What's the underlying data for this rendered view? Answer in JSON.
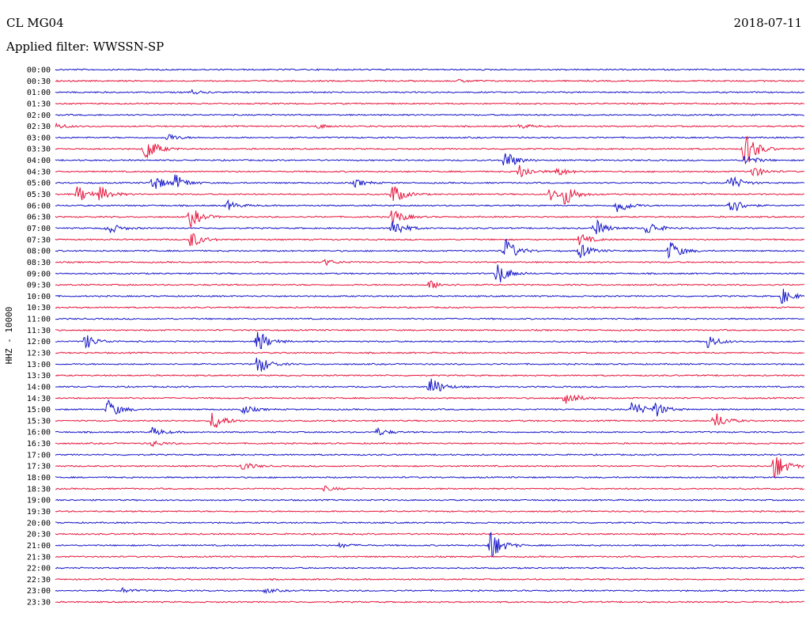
{
  "header": {
    "station": "CL MG04",
    "date": "2018-07-11",
    "filter": "Applied filter: WWSSN-SP"
  },
  "chart_data": {
    "type": "line",
    "ylabel": "HHZ - 10000",
    "tick_labels": [
      "00:00",
      "00:30",
      "01:00",
      "01:30",
      "02:00",
      "02:30",
      "03:00",
      "03:30",
      "04:00",
      "04:30",
      "05:00",
      "05:30",
      "06:00",
      "06:30",
      "07:00",
      "07:30",
      "08:00",
      "08:30",
      "09:00",
      "09:30",
      "10:00",
      "10:30",
      "11:00",
      "11:30",
      "12:00",
      "12:30",
      "13:00",
      "13:30",
      "14:00",
      "14:30",
      "15:00",
      "15:30",
      "16:00",
      "16:30",
      "17:00",
      "17:30",
      "18:00",
      "18:30",
      "19:00",
      "19:30",
      "20:00",
      "20:30",
      "21:00",
      "21:30",
      "22:00",
      "22:30",
      "23:00",
      "23:30"
    ],
    "trace_colors": [
      "#1414c8",
      "#e6143c"
    ],
    "minutes_per_line": 30,
    "events": [
      {
        "row": 1,
        "pos": 0.54,
        "amp": 2
      },
      {
        "row": 2,
        "pos": 0.18,
        "amp": 3
      },
      {
        "row": 5,
        "pos": 0.0,
        "amp": 4
      },
      {
        "row": 5,
        "pos": 0.35,
        "amp": 3
      },
      {
        "row": 5,
        "pos": 0.62,
        "amp": 3
      },
      {
        "row": 6,
        "pos": 0.15,
        "amp": 5
      },
      {
        "row": 7,
        "pos": 0.12,
        "amp": 18
      },
      {
        "row": 7,
        "pos": 0.92,
        "amp": 28
      },
      {
        "row": 8,
        "pos": 0.6,
        "amp": 14
      },
      {
        "row": 8,
        "pos": 0.92,
        "amp": 8
      },
      {
        "row": 9,
        "pos": 0.62,
        "amp": 10
      },
      {
        "row": 9,
        "pos": 0.67,
        "amp": 6
      },
      {
        "row": 9,
        "pos": 0.93,
        "amp": 8
      },
      {
        "row": 10,
        "pos": 0.13,
        "amp": 12
      },
      {
        "row": 10,
        "pos": 0.16,
        "amp": 10
      },
      {
        "row": 10,
        "pos": 0.9,
        "amp": 12
      },
      {
        "row": 10,
        "pos": 0.4,
        "amp": 5
      },
      {
        "row": 11,
        "pos": 0.03,
        "amp": 12
      },
      {
        "row": 11,
        "pos": 0.06,
        "amp": 10
      },
      {
        "row": 11,
        "pos": 0.45,
        "amp": 14
      },
      {
        "row": 11,
        "pos": 0.66,
        "amp": 8
      },
      {
        "row": 11,
        "pos": 0.68,
        "amp": 14
      },
      {
        "row": 12,
        "pos": 0.75,
        "amp": 12
      },
      {
        "row": 12,
        "pos": 0.9,
        "amp": 14
      },
      {
        "row": 12,
        "pos": 0.23,
        "amp": 6
      },
      {
        "row": 13,
        "pos": 0.18,
        "amp": 14
      },
      {
        "row": 13,
        "pos": 0.45,
        "amp": 12
      },
      {
        "row": 14,
        "pos": 0.07,
        "amp": 8
      },
      {
        "row": 14,
        "pos": 0.45,
        "amp": 14
      },
      {
        "row": 14,
        "pos": 0.79,
        "amp": 10
      },
      {
        "row": 14,
        "pos": 0.72,
        "amp": 12
      },
      {
        "row": 15,
        "pos": 0.18,
        "amp": 12
      },
      {
        "row": 15,
        "pos": 0.7,
        "amp": 8
      },
      {
        "row": 16,
        "pos": 0.6,
        "amp": 18
      },
      {
        "row": 16,
        "pos": 0.7,
        "amp": 10
      },
      {
        "row": 16,
        "pos": 0.82,
        "amp": 14
      },
      {
        "row": 17,
        "pos": 0.36,
        "amp": 4
      },
      {
        "row": 18,
        "pos": 0.59,
        "amp": 16
      },
      {
        "row": 19,
        "pos": 0.5,
        "amp": 6
      },
      {
        "row": 20,
        "pos": 0.97,
        "amp": 10
      },
      {
        "row": 24,
        "pos": 0.04,
        "amp": 10
      },
      {
        "row": 24,
        "pos": 0.27,
        "amp": 16
      },
      {
        "row": 24,
        "pos": 0.87,
        "amp": 10
      },
      {
        "row": 26,
        "pos": 0.27,
        "amp": 14
      },
      {
        "row": 28,
        "pos": 0.5,
        "amp": 16
      },
      {
        "row": 29,
        "pos": 0.68,
        "amp": 12
      },
      {
        "row": 30,
        "pos": 0.07,
        "amp": 14
      },
      {
        "row": 30,
        "pos": 0.25,
        "amp": 6
      },
      {
        "row": 30,
        "pos": 0.77,
        "amp": 12
      },
      {
        "row": 30,
        "pos": 0.8,
        "amp": 10
      },
      {
        "row": 31,
        "pos": 0.21,
        "amp": 14
      },
      {
        "row": 31,
        "pos": 0.88,
        "amp": 12
      },
      {
        "row": 32,
        "pos": 0.13,
        "amp": 6
      },
      {
        "row": 32,
        "pos": 0.43,
        "amp": 5
      },
      {
        "row": 33,
        "pos": 0.13,
        "amp": 4
      },
      {
        "row": 35,
        "pos": 0.25,
        "amp": 6
      },
      {
        "row": 35,
        "pos": 0.96,
        "amp": 20
      },
      {
        "row": 37,
        "pos": 0.36,
        "amp": 3
      },
      {
        "row": 42,
        "pos": 0.38,
        "amp": 3
      },
      {
        "row": 42,
        "pos": 0.58,
        "amp": 24
      },
      {
        "row": 46,
        "pos": 0.09,
        "amp": 3
      },
      {
        "row": 46,
        "pos": 0.28,
        "amp": 3
      }
    ]
  }
}
